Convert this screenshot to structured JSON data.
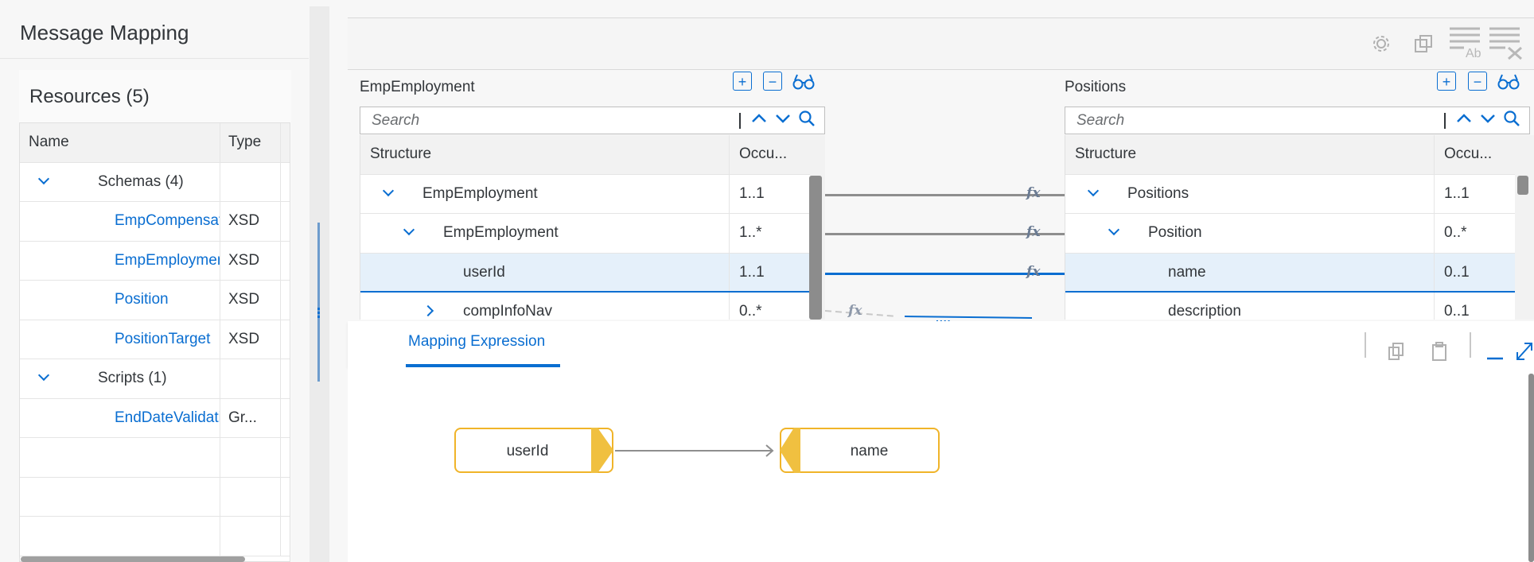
{
  "left": {
    "title": "Message Mapping",
    "resources_title": "Resources (5)",
    "columns": [
      "Name",
      "Type"
    ],
    "rows": [
      {
        "name": "Schemas (4)",
        "type": "",
        "kind": "group",
        "expanded": true
      },
      {
        "name": "EmpCompensation",
        "type": "XSD",
        "kind": "item"
      },
      {
        "name": "EmpEmployment",
        "type": "XSD",
        "kind": "item"
      },
      {
        "name": "Position",
        "type": "XSD",
        "kind": "item"
      },
      {
        "name": "PositionTarget",
        "type": "XSD",
        "kind": "item"
      },
      {
        "name": "Scripts (1)",
        "type": "",
        "kind": "group",
        "expanded": true
      },
      {
        "name": "EndDateValidation",
        "type": "Gr...",
        "kind": "item"
      }
    ]
  },
  "toolbar": {
    "icons": [
      "settings-icon",
      "copy-structure-icon",
      "text-format-icon",
      "clear-lines-icon"
    ]
  },
  "source": {
    "title": "EmpEmployment",
    "search_placeholder": "Search",
    "col_structure": "Structure",
    "col_occurrence": "Occu...",
    "rows": [
      {
        "label": "EmpEmployment",
        "occ": "1..1",
        "level": 0,
        "toggle": "down"
      },
      {
        "label": "EmpEmployment",
        "occ": "1..*",
        "level": 1,
        "toggle": "down"
      },
      {
        "label": "userId",
        "occ": "1..1",
        "level": 2,
        "toggle": "",
        "selected": true
      },
      {
        "label": "compInfoNav",
        "occ": "0..*",
        "level": 1,
        "toggle": "right"
      }
    ]
  },
  "target": {
    "title": "Positions",
    "search_placeholder": "Search",
    "col_structure": "Structure",
    "col_occurrence": "Occu...",
    "rows": [
      {
        "label": "Positions",
        "occ": "1..1",
        "level": 0,
        "toggle": "down"
      },
      {
        "label": "Position",
        "occ": "0..*",
        "level": 1,
        "toggle": "down"
      },
      {
        "label": "name",
        "occ": "0..1",
        "level": 2,
        "toggle": "",
        "selected": true
      },
      {
        "label": "description",
        "occ": "0..1",
        "level": 2,
        "toggle": ""
      }
    ]
  },
  "mapping": {
    "fx_label": "fx",
    "more_label": "...."
  },
  "expression": {
    "tab_label": "Mapping Expression",
    "source_node": "userId",
    "target_node": "name"
  },
  "colors": {
    "accent": "#0a6ed1",
    "node_border": "#f0b429",
    "node_tab": "#f0c040",
    "text": "#32363a"
  }
}
